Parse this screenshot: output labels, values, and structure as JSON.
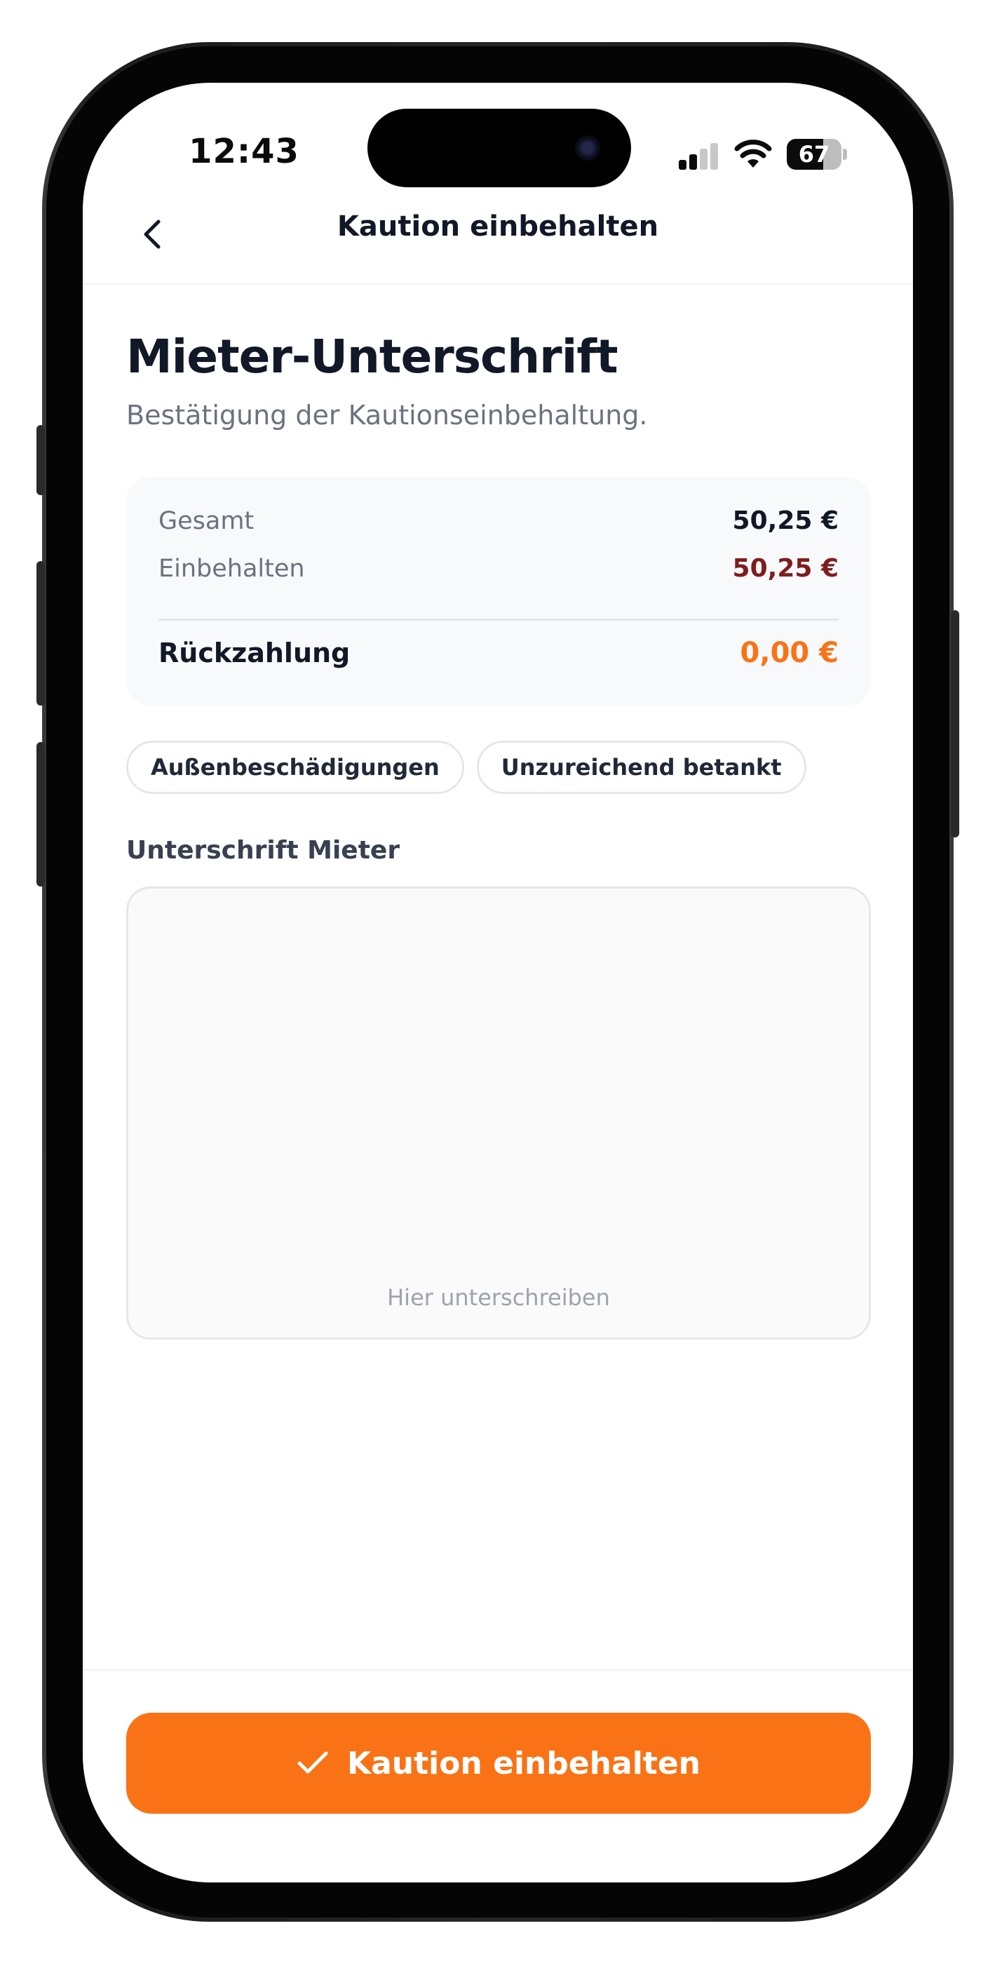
{
  "status_bar": {
    "time": "12:43",
    "battery_level": "67",
    "battery_fraction": 0.67,
    "signal_bars_active": 2,
    "signal_bars_total": 4
  },
  "nav": {
    "back_icon": "chevron-left-icon",
    "title": "Kaution einbehalten"
  },
  "header": {
    "title": "Mieter-Unterschrift",
    "subtitle": "Bestätigung der Kautionseinbehaltung."
  },
  "summary": {
    "total_label": "Gesamt",
    "total_value": "50,25 €",
    "retained_label": "Einbehalten",
    "retained_value": "50,25 €",
    "refund_label": "Rückzahlung",
    "refund_value": "0,00 €"
  },
  "chips": [
    {
      "label": "Außenbeschädigungen"
    },
    {
      "label": "Unzureichend betankt"
    }
  ],
  "signature": {
    "label": "Unterschrift Mieter",
    "hint": "Hier unterschreiben"
  },
  "action": {
    "icon": "check-icon",
    "label": "Kaution einbehalten"
  },
  "colors": {
    "accent": "#f97316",
    "retained": "#7f1d1d",
    "text_primary": "#111827",
    "text_secondary": "#6b7280"
  }
}
